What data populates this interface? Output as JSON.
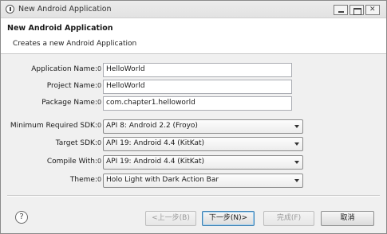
{
  "window": {
    "title": "New Android Application"
  },
  "header": {
    "title": "New Android Application",
    "description": "Creates a new Android Application"
  },
  "form": {
    "application_name": {
      "label": "Application Name:",
      "hint": "0",
      "value": "HelloWorld"
    },
    "project_name": {
      "label": "Project Name:",
      "hint": "0",
      "value": "HelloWorld"
    },
    "package_name": {
      "label": "Package Name:",
      "hint": "0",
      "value": "com.chapter1.helloworld"
    },
    "min_sdk": {
      "label": "Minimum Required SDK:",
      "hint": "0",
      "value": "API 8: Android 2.2 (Froyo)"
    },
    "target_sdk": {
      "label": "Target SDK:",
      "hint": "0",
      "value": "API 19: Android 4.4 (KitKat)"
    },
    "compile_with": {
      "label": "Compile With:",
      "hint": "0",
      "value": "API 19: Android 4.4 (KitKat)"
    },
    "theme": {
      "label": "Theme:",
      "hint": "0",
      "value": "Holo Light with Dark Action Bar"
    }
  },
  "buttons": {
    "help": "?",
    "back": "<上一步(B)",
    "next": "下一步(N)>",
    "finish": "完成(F)",
    "cancel": "取消"
  }
}
